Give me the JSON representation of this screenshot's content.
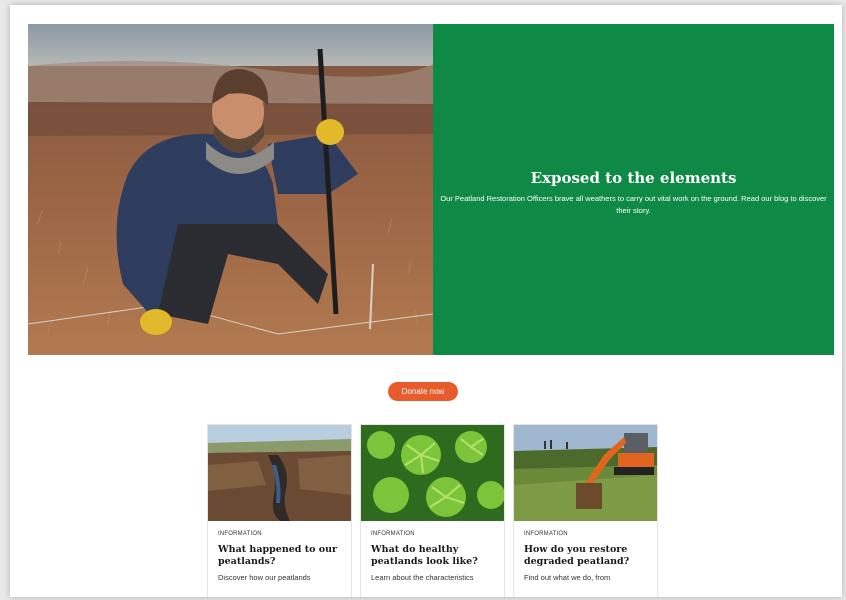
{
  "hero": {
    "title": "Exposed to the elements",
    "body": "Our Peatland Restoration Officers brave all weathers to carry out vital work on the ground. Read our blog to discover their story.",
    "panel_color": "#0f8a46"
  },
  "donate": {
    "label": "Donate now",
    "color": "#e85c2c"
  },
  "cards": [
    {
      "category": "INFORMATION",
      "title": "What happened to our peatlands?",
      "description": "Discover how our peatlands"
    },
    {
      "category": "INFORMATION",
      "title": "What do healthy peatlands look like?",
      "description": "Learn about the characteristics"
    },
    {
      "category": "INFORMATION",
      "title": "How do you restore degraded peatland?",
      "description": "Find out what we do, from"
    }
  ]
}
